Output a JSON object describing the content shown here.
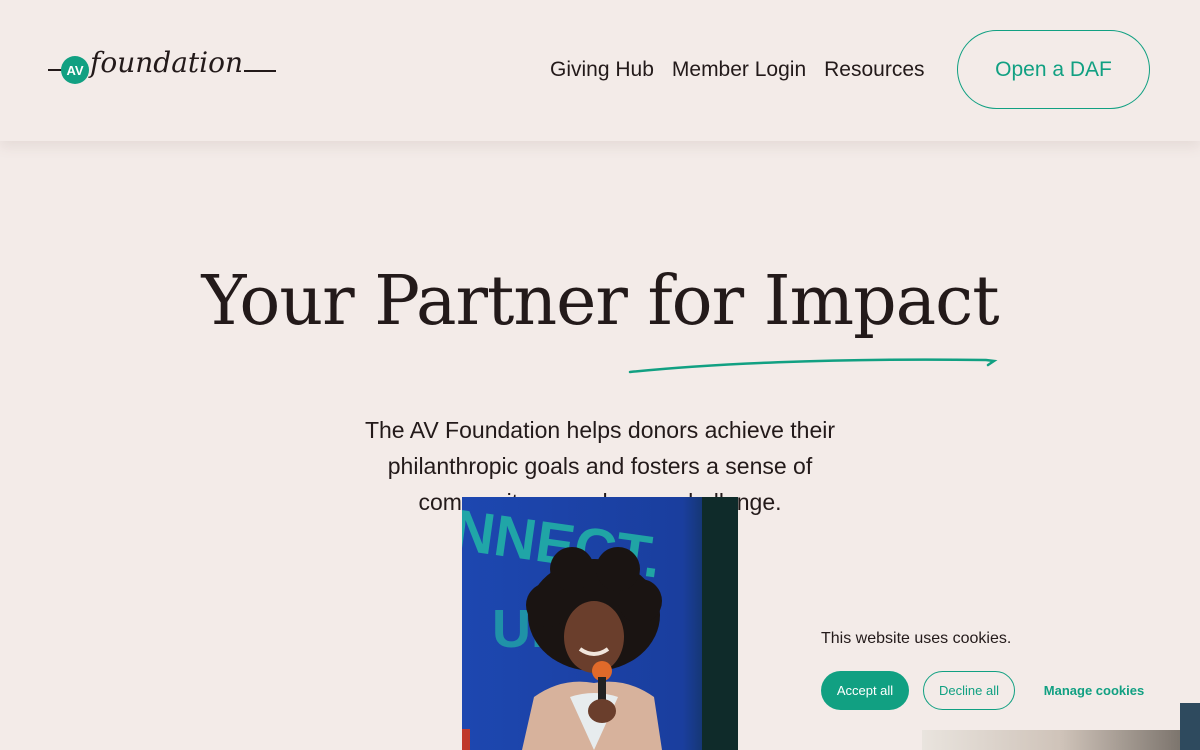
{
  "header": {
    "logo_text": "foundation",
    "logo_badge": "AV",
    "nav": [
      "Giving Hub",
      "Member Login",
      "Resources"
    ],
    "cta_label": "Open a DAF"
  },
  "hero": {
    "title": "Your Partner for Impact",
    "subtitle": "The AV Foundation helps donors achieve their philanthropic goals and fosters a sense of community around every challenge."
  },
  "cookie": {
    "message": "This website uses cookies.",
    "accept_label": "Accept all",
    "decline_label": "Decline all",
    "manage_label": "Manage cookies"
  },
  "colors": {
    "accent": "#11a082",
    "background": "#f3ebe8",
    "text": "#231a1a"
  }
}
